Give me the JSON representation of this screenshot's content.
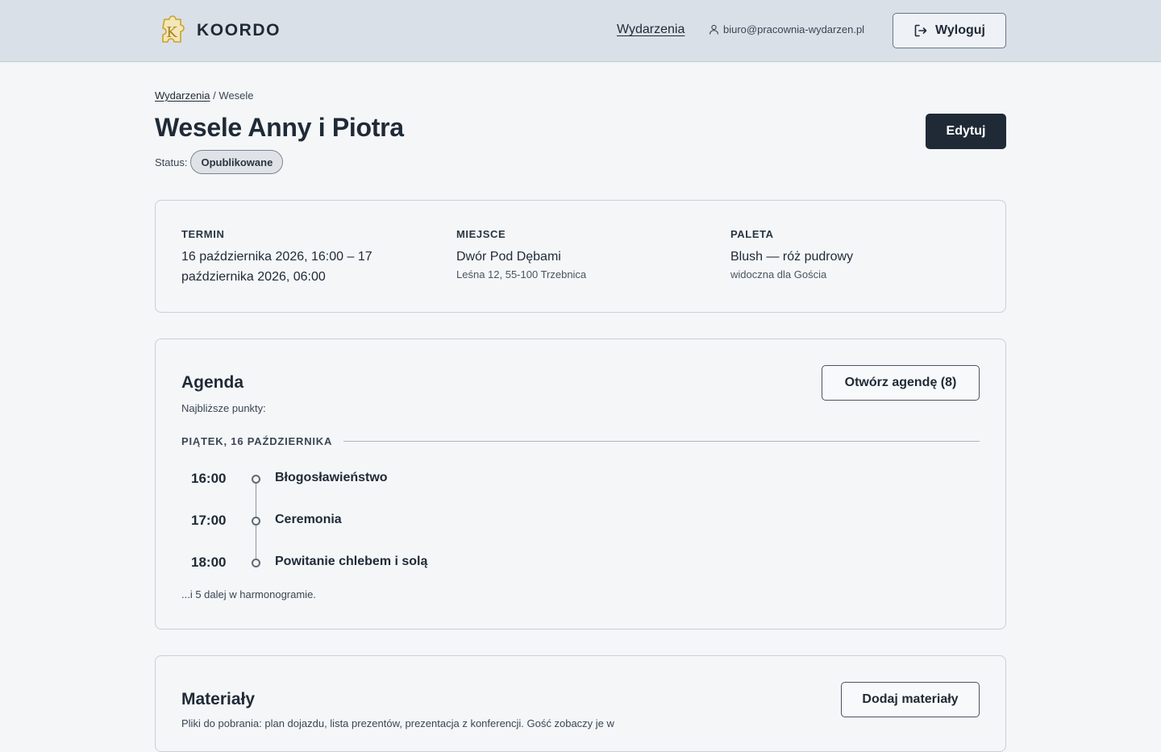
{
  "header": {
    "brand": "KOORDO",
    "logo_letter": "K",
    "nav_events": "Wydarzenia",
    "user_email": "biuro@pracownia-wydarzen.pl",
    "logout_label": "Wyloguj"
  },
  "breadcrumb": {
    "root": "Wydarzenia",
    "separator": "/",
    "current": "Wesele"
  },
  "event": {
    "title": "Wesele Anny i Piotra",
    "status_label": "Status:",
    "status_value": "Opublikowane",
    "edit_label": "Edytuj"
  },
  "info": {
    "term_label": "TERMIN",
    "term_value": "16 października 2026, 16:00 – 17 października 2026, 06:00",
    "place_label": "MIEJSCE",
    "place_value": "Dwór Pod Dębami",
    "place_address": "Leśna 12, 55-100 Trzebnica",
    "palette_label": "PALETA",
    "palette_value": "Blush — róż pudrowy",
    "palette_note": "widoczna dla Gościa"
  },
  "agenda": {
    "title": "Agenda",
    "open_button": "Otwórz agendę (8)",
    "subtitle": "Najbliższe punkty:",
    "day_label": "PIĄTEK, 16 PAŹDZIERNIKA",
    "items": [
      {
        "time": "16:00",
        "title": "Błogosławieństwo"
      },
      {
        "time": "17:00",
        "title": "Ceremonia"
      },
      {
        "time": "18:00",
        "title": "Powitanie chlebem i solą"
      }
    ],
    "more_note": "...i 5 dalej w harmonogramie."
  },
  "materials": {
    "title": "Materiały",
    "add_button": "Dodaj materiały",
    "description": "Pliki do pobrania: plan dojazdu, lista prezentów, prezentacja z konferencji. Gość zobaczy je w"
  },
  "colors": {
    "header_bg": "#d9e0e8",
    "page_bg": "#f4f6f8",
    "primary": "#1f2a36",
    "logo_gold": "#c9a227"
  },
  "icons": {
    "user": "user-icon",
    "logout": "logout-icon",
    "logo": "puzzle-logo-icon"
  }
}
